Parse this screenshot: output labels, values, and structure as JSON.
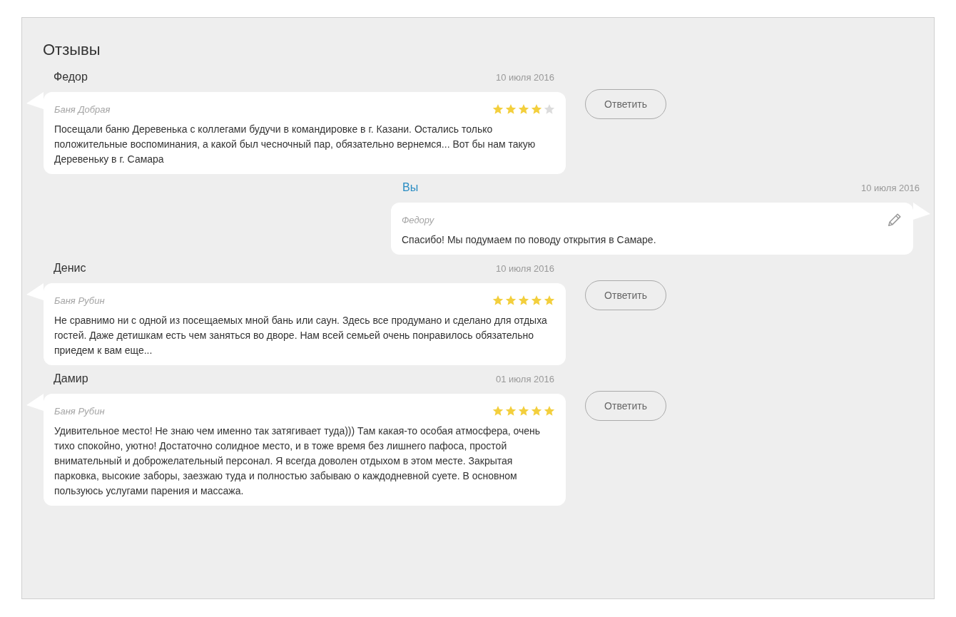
{
  "title": "Отзывы",
  "items": [
    {
      "kind": "review",
      "author": "Федор",
      "date": "10 июля 2016",
      "place": "Баня Добрая",
      "stars": 4,
      "text": "Посещали баню Деревенька с коллегами будучи в командировке в г. Казани. Остались только положительные воспоминания, а какой был чесночный пар, обязательно вернемся... Вот бы нам такую Деревеньку в г. Самара",
      "button": "Ответить"
    },
    {
      "kind": "reply",
      "author": "Вы",
      "date": "10 июля 2016",
      "place": "Федору",
      "text": "Спасибо! Мы подумаем по поводу открытия в Самаре."
    },
    {
      "kind": "review",
      "author": "Денис",
      "date": "10 июля 2016",
      "place": "Баня Рубин",
      "stars": 5,
      "text": "Не сравнимо ни с одной из посещаемых мной бань или саун. Здесь все продумано и сделано для отдыха гостей. Даже детишкам есть чем заняться во дворе. Нам всей семьей очень понравилось обязательно приедем к вам еще...",
      "button": "Ответить"
    },
    {
      "kind": "review",
      "author": "Дамир",
      "date": "01 июля 2016",
      "place": "Баня Рубин",
      "stars": 5,
      "text": "Удивительное место! Не знаю чем именно так затягивает туда))) Там какая-то особая атмосфера, очень тихо спокойно, уютно! Достаточно солидное место, и в тоже время без лишнего пафоса, простой внимательный и доброжелательный персонал. Я всегда доволен отдыхом в этом месте. Закрытая парковка, высокие заборы, заезжаю туда и полностью забываю о каждодневной суете. В основном пользуюсь услугами парения и массажа.",
      "button": "Ответить"
    }
  ]
}
